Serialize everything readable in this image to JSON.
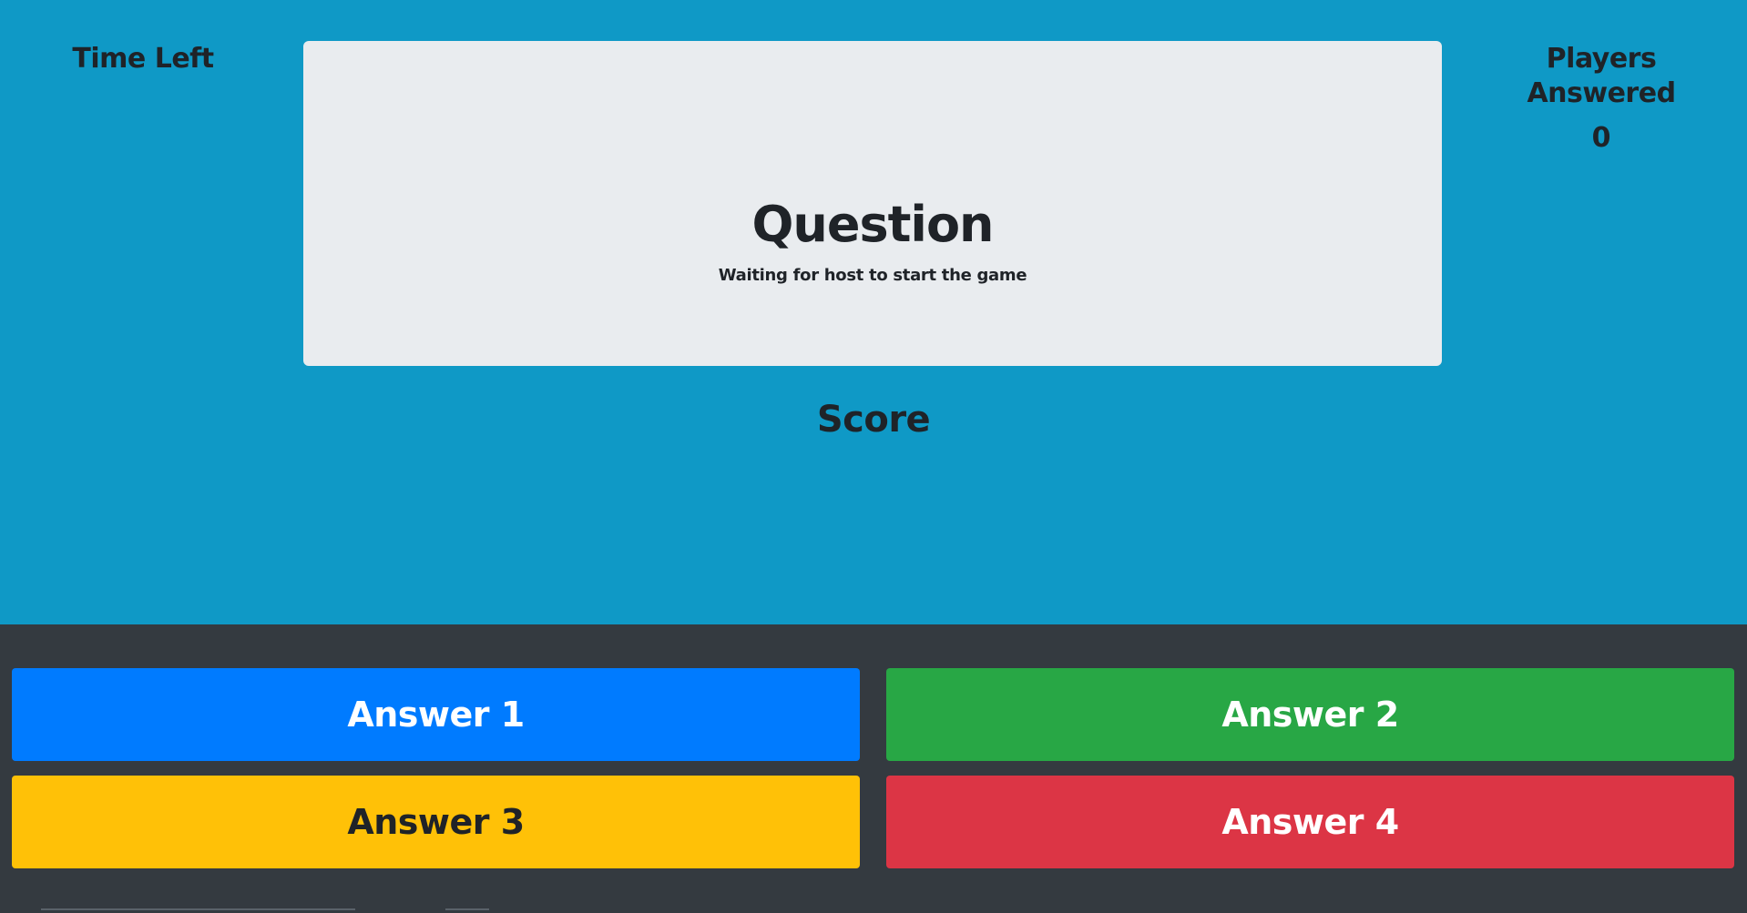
{
  "colors": {
    "top_background": "#0f99c6",
    "bottom_background": "#343a40",
    "card_background": "#e9ecef",
    "text_dark": "#1f2328",
    "answer_1": "#007bff",
    "answer_2": "#28a745",
    "answer_3": "#ffc107",
    "answer_4": "#dc3545"
  },
  "header": {
    "time_left_label": "Time Left",
    "players_answered_label": "Players Answered",
    "players_answered_count": "0"
  },
  "question": {
    "title": "Question",
    "subtitle": "Waiting for host to start the game"
  },
  "score": {
    "label": "Score"
  },
  "answers": [
    {
      "label": "Answer 1"
    },
    {
      "label": "Answer 2"
    },
    {
      "label": "Answer 3"
    },
    {
      "label": "Answer 4"
    }
  ]
}
